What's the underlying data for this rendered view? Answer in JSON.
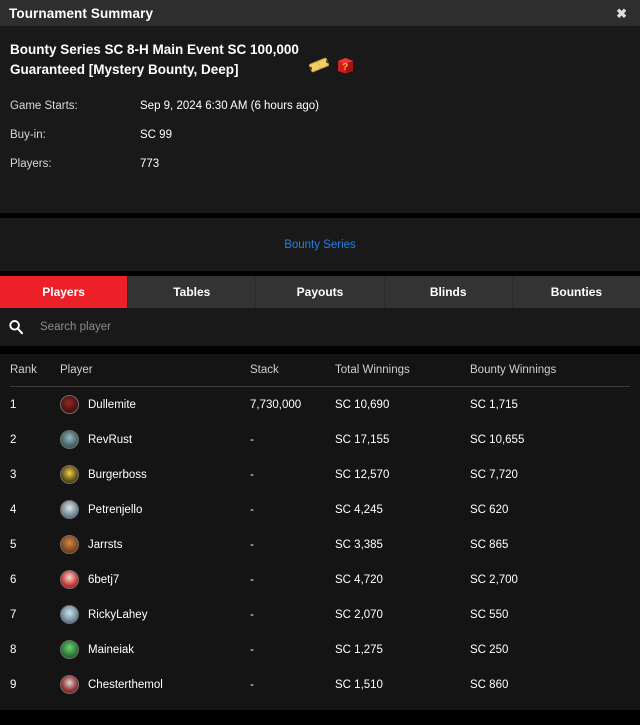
{
  "window": {
    "title": "Tournament Summary",
    "close_label": "✖"
  },
  "summary": {
    "tournament_name": "Bounty Series SC 8-H Main Event SC 100,000 Guaranteed [Mystery Bounty, Deep]",
    "badges": [
      {
        "name": "ticket-icon",
        "label": "Ticket"
      },
      {
        "name": "mystery-bounty-icon",
        "label": "Mystery Bounty"
      }
    ],
    "info": [
      {
        "label": "Game Starts:",
        "value": "Sep 9, 2024 6:30 AM (6 hours ago)"
      },
      {
        "label": "Buy-in:",
        "value": "SC 99"
      },
      {
        "label": "Players:",
        "value": "773"
      }
    ]
  },
  "series": {
    "link_label": "Bounty Series"
  },
  "tabs": [
    {
      "label": "Players",
      "active": true
    },
    {
      "label": "Tables",
      "active": false
    },
    {
      "label": "Payouts",
      "active": false
    },
    {
      "label": "Blinds",
      "active": false
    },
    {
      "label": "Bounties",
      "active": false
    }
  ],
  "search": {
    "placeholder": "Search player",
    "value": ""
  },
  "table": {
    "columns": [
      "Rank",
      "Player",
      "Stack",
      "Total Winnings",
      "Bounty Winnings"
    ],
    "rows": [
      {
        "rank": "1",
        "player": "Dullemite",
        "stack": "7,730,000",
        "total": "SC 10,690",
        "bounty": "SC 1,715",
        "avatar": "avatar-dullemite"
      },
      {
        "rank": "2",
        "player": "RevRust",
        "stack": "-",
        "total": "SC 17,155",
        "bounty": "SC 10,655",
        "avatar": "avatar-revrust"
      },
      {
        "rank": "3",
        "player": "Burgerboss",
        "stack": "-",
        "total": "SC 12,570",
        "bounty": "SC 7,720",
        "avatar": "avatar-burgerboss"
      },
      {
        "rank": "4",
        "player": "Petrenjello",
        "stack": "-",
        "total": "SC 4,245",
        "bounty": "SC 620",
        "avatar": "avatar-petrenjello"
      },
      {
        "rank": "5",
        "player": "Jarrsts",
        "stack": "-",
        "total": "SC 3,385",
        "bounty": "SC 865",
        "avatar": "avatar-jarrsts"
      },
      {
        "rank": "6",
        "player": "6betj7",
        "stack": "-",
        "total": "SC 4,720",
        "bounty": "SC 2,700",
        "avatar": "avatar-6betj7"
      },
      {
        "rank": "7",
        "player": "RickyLahey",
        "stack": "-",
        "total": "SC 2,070",
        "bounty": "SC 550",
        "avatar": "avatar-rickylahey"
      },
      {
        "rank": "8",
        "player": "Maineiak",
        "stack": "-",
        "total": "SC 1,275",
        "bounty": "SC 250",
        "avatar": "avatar-maineiak"
      },
      {
        "rank": "9",
        "player": "Chesterthemol",
        "stack": "-",
        "total": "SC 1,510",
        "bounty": "SC 860",
        "avatar": "avatar-chesterthemol"
      }
    ]
  },
  "colors": {
    "accent_red": "#ed2029",
    "link_blue": "#2a7fe0",
    "titlebar_bg": "#2e2e2e",
    "panel_bg": "#191919",
    "table_bg": "#141414"
  }
}
